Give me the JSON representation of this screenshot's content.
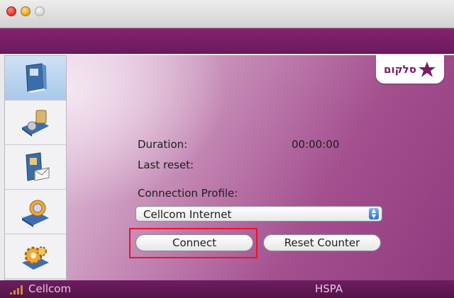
{
  "window": {
    "controls": [
      "close",
      "minimize",
      "zoom"
    ]
  },
  "sidebar": {
    "items": [
      {
        "name": "phone-book",
        "icon": "phone-book-icon",
        "selected": true
      },
      {
        "name": "sim-card",
        "icon": "sim-card-icon",
        "selected": false
      },
      {
        "name": "sms",
        "icon": "sms-icon",
        "selected": false
      },
      {
        "name": "connection",
        "icon": "connection-icon",
        "selected": false
      },
      {
        "name": "settings",
        "icon": "gear-icon",
        "selected": false
      }
    ]
  },
  "brand": {
    "logo_text": "סלקום",
    "logo_color": "#7a1b64"
  },
  "main": {
    "duration_label": "Duration:",
    "duration_value": "00:00:00",
    "last_reset_label": "Last reset:",
    "profile_label": "Connection Profile:",
    "profile_selected": "Cellcom Internet",
    "connect_label": "Connect",
    "reset_label": "Reset Counter"
  },
  "status": {
    "carrier": "Cellcom",
    "network": "HSPA"
  },
  "colors": {
    "accent": "#7a1b64",
    "highlight": "#e8142a"
  }
}
